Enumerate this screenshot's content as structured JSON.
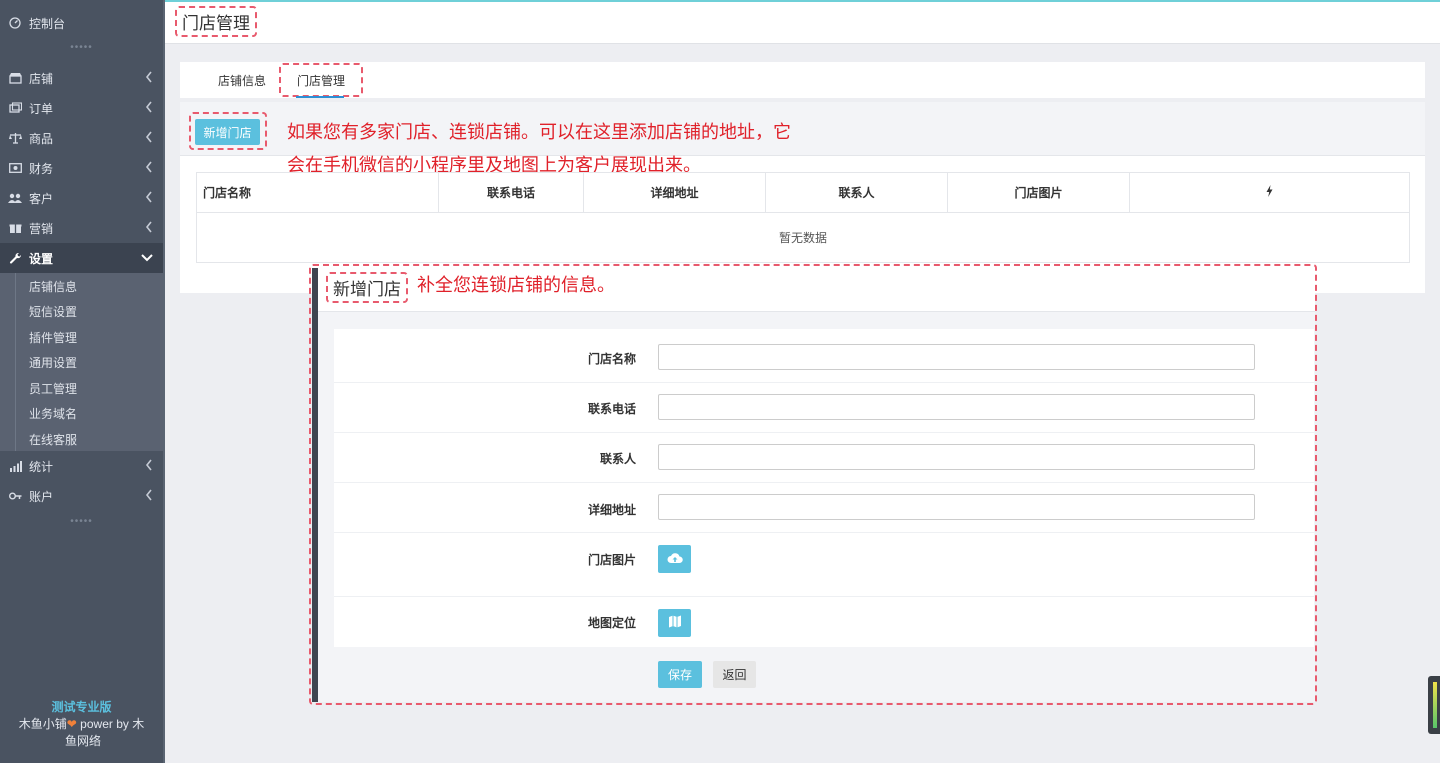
{
  "sidebar": {
    "dashboard": "控制台",
    "items": [
      {
        "label": "店铺"
      },
      {
        "label": "订单"
      },
      {
        "label": "商品"
      },
      {
        "label": "财务"
      },
      {
        "label": "客户"
      },
      {
        "label": "营销"
      },
      {
        "label": "设置"
      },
      {
        "label": "统计"
      },
      {
        "label": "账户"
      }
    ],
    "sub_items": [
      {
        "label": "店铺信息"
      },
      {
        "label": "短信设置"
      },
      {
        "label": "插件管理"
      },
      {
        "label": "通用设置"
      },
      {
        "label": "员工管理"
      },
      {
        "label": "业务域名"
      },
      {
        "label": "在线客服"
      }
    ],
    "brand": {
      "version": "测试专业版",
      "line1_pre": "木鱼小铺",
      "line1_post": " power by 木",
      "line2": "鱼网络"
    }
  },
  "header": {
    "title": "门店管理"
  },
  "tabs": [
    {
      "label": "店铺信息"
    },
    {
      "label": "门店管理"
    }
  ],
  "toolbar": {
    "add_label": "新增门店"
  },
  "annotations": {
    "main_line1": "如果您有多家门店、连锁店铺。可以在这里添加店铺的地址，它",
    "main_line2": "会在手机微信的小程序里及地图上为客户展现出来。",
    "modal_note": "补全您连锁店铺的信息。"
  },
  "table": {
    "columns": [
      "门店名称",
      "联系电话",
      "详细地址",
      "联系人",
      "门店图片"
    ],
    "empty_text": "暂无数据"
  },
  "modal": {
    "title": "新增门店",
    "fields": {
      "name": {
        "label": "门店名称",
        "value": ""
      },
      "phone": {
        "label": "联系电话",
        "value": ""
      },
      "contact": {
        "label": "联系人",
        "value": ""
      },
      "address": {
        "label": "详细地址",
        "value": ""
      }
    },
    "image_label": "门店图片",
    "map_label": "地图定位",
    "save_label": "保存",
    "back_label": "返回"
  },
  "colors": {
    "accent": "#5bc0de",
    "sidebar_bg": "#4a5361",
    "annotation_red": "#e0212a",
    "highlight_box": "#e85a6d"
  },
  "icons": {
    "dashboard": "gauge-icon",
    "shop": "shop-icon",
    "order": "order-icon",
    "goods": "scale-icon",
    "finance": "money-icon",
    "customer": "users-icon",
    "marketing": "gift-icon",
    "settings": "wrench-icon",
    "stats": "bar-chart-icon",
    "account": "key-icon",
    "table_action": "bolt-icon",
    "upload": "cloud-upload-icon",
    "map": "map-icon"
  }
}
